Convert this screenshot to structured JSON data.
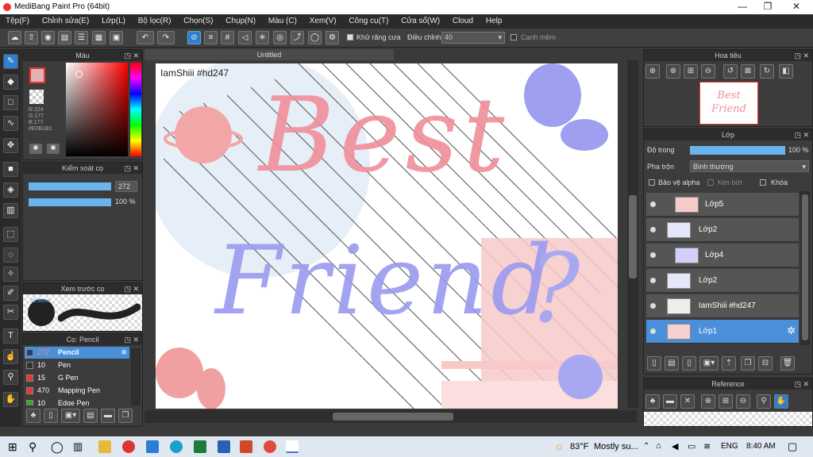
{
  "window": {
    "title": "MediBang Paint Pro (64bit)",
    "min": "—",
    "max": "❐",
    "close": "✕"
  },
  "menu": [
    "Tệp(F)",
    "Chỉnh sửa(E)",
    "Lớp(L)",
    "Bộ lọc(R)",
    "Chọn(S)",
    "Chụp(N)",
    "Màu (C)",
    "Xem(V)",
    "Công cụ(T)",
    "Cửa sổ(W)",
    "Cloud",
    "Help"
  ],
  "toolbar": {
    "antialias_label": "Khử răng cưa",
    "adjust_label": "Điều chỉnh",
    "adjust_value": "40",
    "smooth_label": "Cạnh mềm"
  },
  "color_panel": {
    "title": "Màu",
    "r": "R:224",
    "g": "G:177",
    "b": "B:177",
    "hex": "#E0B1B1",
    "primary": "#e0b1b1"
  },
  "brush_control": {
    "title": "Kiểm soát cọ",
    "size": "272",
    "opacity": "100 %"
  },
  "brush_preview": {
    "title": "Xem trước cọ",
    "size_text": "19.8mm"
  },
  "brush_list": {
    "title": "Cọ: Pencil",
    "items": [
      {
        "size": "272",
        "name": "Pencil",
        "color": "#2a3f66"
      },
      {
        "size": "10",
        "name": "Pen",
        "color": "#333"
      },
      {
        "size": "15",
        "name": "G Pen",
        "color": "#e33"
      },
      {
        "size": "470",
        "name": "Mapping Pen",
        "color": "#e33"
      },
      {
        "size": "10",
        "name": "Edge Pen",
        "color": "#3a3"
      }
    ]
  },
  "canvas": {
    "tab": "Untitled",
    "watermark": "IamShiii #hd247",
    "title_line1": "Best",
    "title_line2": "Friend",
    "question": "?"
  },
  "navigator": {
    "title": "Hoa tiêu",
    "thumb_text": "Best Friend"
  },
  "layer_panel": {
    "title": "Lớp",
    "opacity_label": "Độ trong",
    "opacity_value": "100 %",
    "blend_label": "Pha trộn",
    "blend_value": "Bình thường",
    "protect_alpha": "Bảo vệ alpha",
    "clip": "Xén bớt",
    "lock": "Khóa",
    "layers": [
      "Lớp5",
      "Lớp2",
      "Lớp4",
      "Lớp2",
      "IamShiii #hd247",
      "Lớp1"
    ]
  },
  "reference": {
    "title": "Reference"
  },
  "taskbar": {
    "weather_temp": "83°F",
    "weather_text": "Mostly su...",
    "lang": "ENG",
    "time": "8:40 AM"
  }
}
